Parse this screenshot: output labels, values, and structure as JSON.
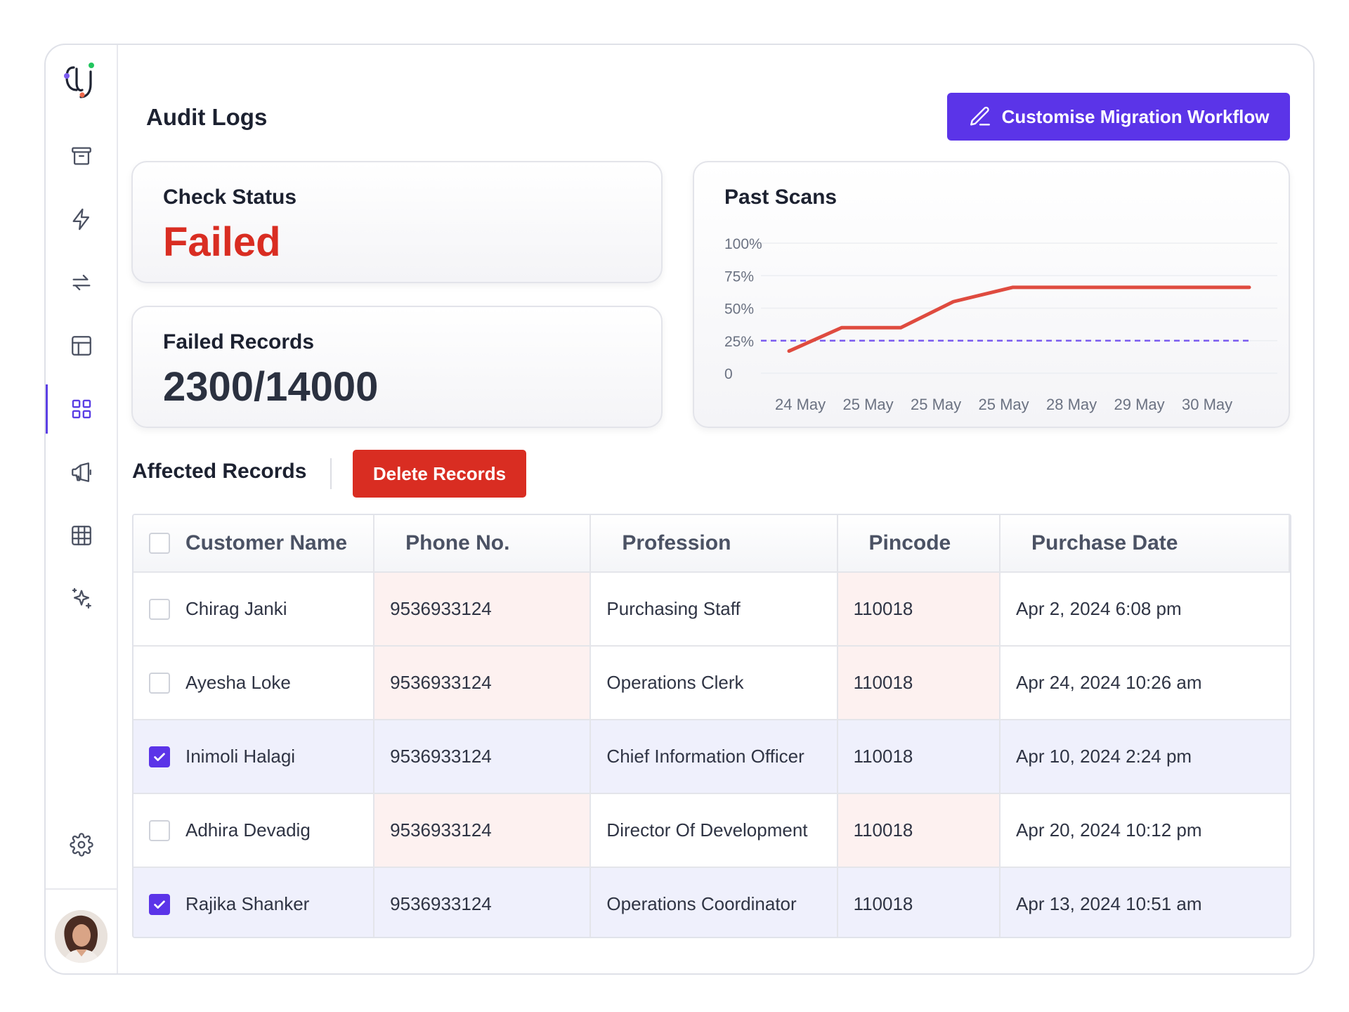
{
  "page": {
    "title": "Audit Logs"
  },
  "toolbar": {
    "customise_label": "Customise Migration Workflow"
  },
  "sidebar": {
    "items": [
      {
        "icon": "archive-icon"
      },
      {
        "icon": "lightning-icon"
      },
      {
        "icon": "arrows-transfer-icon"
      },
      {
        "icon": "layout-icon"
      },
      {
        "icon": "grid-icon",
        "active": true
      },
      {
        "icon": "megaphone-icon"
      },
      {
        "icon": "table-icon"
      },
      {
        "icon": "sparkles-icon"
      }
    ],
    "settings_icon": "gear-icon",
    "brand_color": "#5b3fe4"
  },
  "check_status": {
    "label": "Check Status",
    "value": "Failed",
    "color": "#d92d22"
  },
  "failed_records": {
    "label": "Failed Records",
    "value": "2300/14000"
  },
  "chart_data": {
    "type": "line",
    "title": "Past Scans",
    "x": [
      "24 May",
      "25 May",
      "25 May",
      "25 May",
      "28 May",
      "29 May",
      "30 May"
    ],
    "y_ticks": [
      "100%",
      "75%",
      "50%",
      "25%",
      "0"
    ],
    "ylim": [
      0,
      100
    ],
    "series": [
      {
        "values": [
          17,
          35,
          35,
          55,
          66,
          66,
          66,
          66,
          66,
          66
        ],
        "x_positions": [
          0,
          0.8,
          1.7,
          2.5,
          3.4,
          4.2,
          5.0,
          5.8,
          6.5,
          7.0
        ],
        "color": "#df4b3f"
      }
    ],
    "reference_line": {
      "value": 25,
      "color": "#7b5cf0",
      "style": "dashed"
    },
    "grid": true
  },
  "affected": {
    "title": "Affected Records",
    "delete_label": "Delete Records"
  },
  "table": {
    "columns": [
      "Customer Name",
      "Phone No.",
      "Profession",
      "Pincode",
      "Purchase Date"
    ],
    "rows": [
      {
        "checked": false,
        "name": "Chirag Janki",
        "phone": "9536933124",
        "profession": "Purchasing Staff",
        "pincode": "110018",
        "date": "Apr 2, 2024 6:08 pm"
      },
      {
        "checked": false,
        "name": "Ayesha Loke",
        "phone": "9536933124",
        "profession": "Operations Clerk",
        "pincode": "110018",
        "date": "Apr 24, 2024 10:26 am"
      },
      {
        "checked": true,
        "name": "Inimoli Halagi",
        "phone": "9536933124",
        "profession": "Chief Information Officer",
        "pincode": "110018",
        "date": "Apr 10, 2024 2:24 pm"
      },
      {
        "checked": false,
        "name": "Adhira Devadig",
        "phone": "9536933124",
        "profession": "Director Of Development",
        "pincode": "110018",
        "date": "Apr 20, 2024 10:12 pm"
      },
      {
        "checked": true,
        "name": "Rajika Shanker",
        "phone": "9536933124",
        "profession": "Operations Coordinator",
        "pincode": "110018",
        "date": "Apr 13, 2024 10:51 am"
      }
    ]
  }
}
